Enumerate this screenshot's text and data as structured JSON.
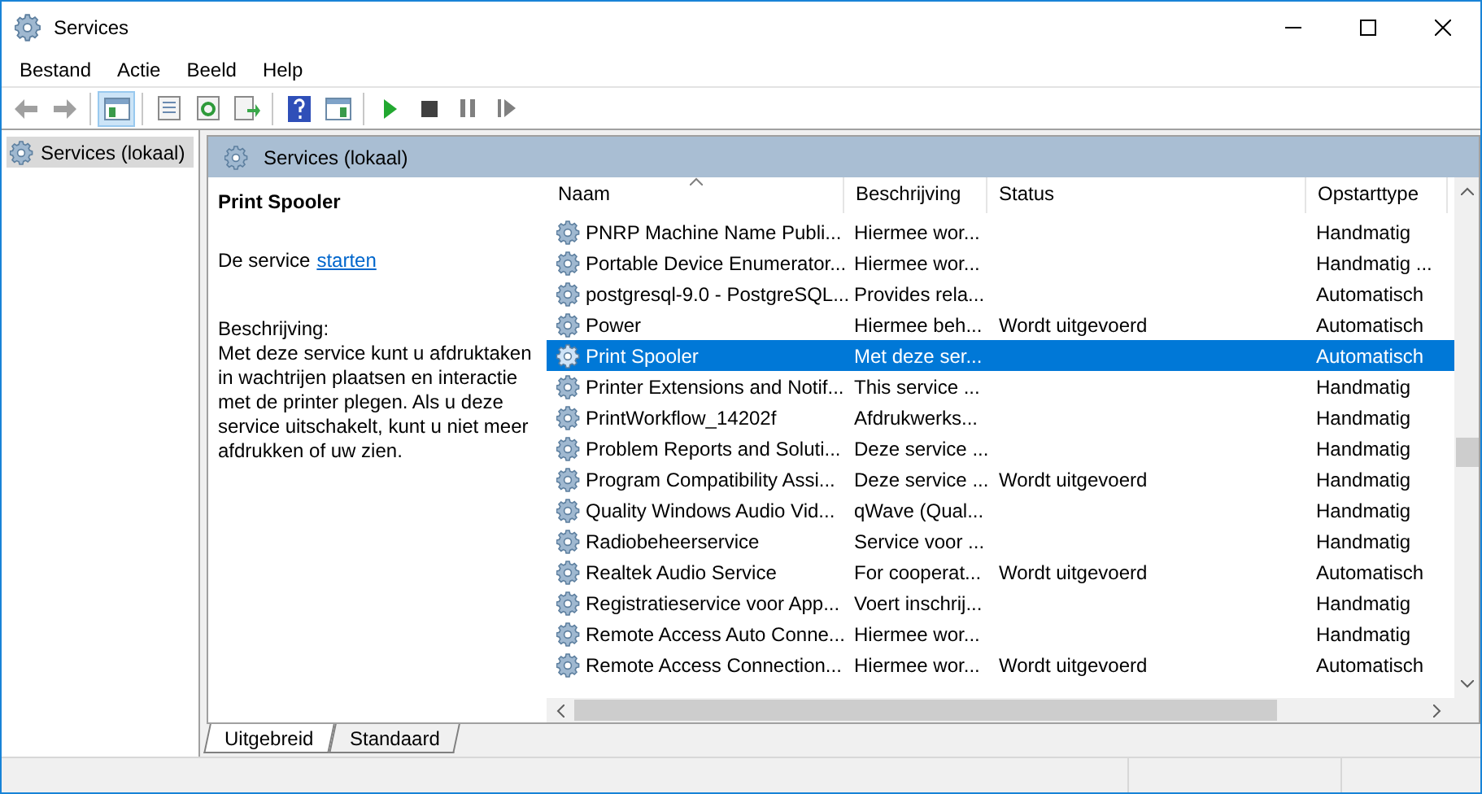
{
  "window": {
    "title": "Services"
  },
  "menu": [
    "Bestand",
    "Actie",
    "Beeld",
    "Help"
  ],
  "tree": {
    "items": [
      {
        "label": "Services (lokaal)",
        "selected": true
      }
    ]
  },
  "pane_header": {
    "title": "Services (lokaal)"
  },
  "details": {
    "title": "Print Spooler",
    "action_prefix": "De service",
    "action_link": "starten",
    "description_label": "Beschrijving:",
    "description": "Met deze service kunt u afdruktaken in wachtrijen plaatsen en interactie met de printer plegen. Als u deze service uitschakelt, kunt u niet meer afdrukken of uw zien."
  },
  "table": {
    "columns": [
      "Naam",
      "Beschrijving",
      "Status",
      "Opstarttype"
    ],
    "rows": [
      {
        "name": "PNRP Machine Name Publi...",
        "description": "Hiermee wor...",
        "status": "",
        "startup": "Handmatig",
        "selected": false
      },
      {
        "name": "Portable Device Enumerator...",
        "description": "Hiermee wor...",
        "status": "",
        "startup": "Handmatig ...",
        "selected": false
      },
      {
        "name": "postgresql-9.0 - PostgreSQL...",
        "description": "Provides rela...",
        "status": "",
        "startup": "Automatisch",
        "selected": false
      },
      {
        "name": "Power",
        "description": "Hiermee beh...",
        "status": "Wordt uitgevoerd",
        "startup": "Automatisch",
        "selected": false
      },
      {
        "name": "Print Spooler",
        "description": "Met deze ser...",
        "status": "",
        "startup": "Automatisch",
        "selected": true
      },
      {
        "name": "Printer Extensions and Notif...",
        "description": "This service ...",
        "status": "",
        "startup": "Handmatig",
        "selected": false
      },
      {
        "name": "PrintWorkflow_14202f",
        "description": "Afdrukwerks...",
        "status": "",
        "startup": "Handmatig",
        "selected": false
      },
      {
        "name": "Problem Reports and Soluti...",
        "description": "Deze service ...",
        "status": "",
        "startup": "Handmatig",
        "selected": false
      },
      {
        "name": "Program Compatibility Assi...",
        "description": "Deze service ...",
        "status": "Wordt uitgevoerd",
        "startup": "Handmatig",
        "selected": false
      },
      {
        "name": "Quality Windows Audio Vid...",
        "description": "qWave (Qual...",
        "status": "",
        "startup": "Handmatig",
        "selected": false
      },
      {
        "name": "Radiobeheerservice",
        "description": "Service voor ...",
        "status": "",
        "startup": "Handmatig",
        "selected": false
      },
      {
        "name": "Realtek Audio Service",
        "description": "For cooperat...",
        "status": "Wordt uitgevoerd",
        "startup": "Automatisch",
        "selected": false
      },
      {
        "name": "Registratieservice voor App...",
        "description": "Voert inschrij...",
        "status": "",
        "startup": "Handmatig",
        "selected": false
      },
      {
        "name": "Remote Access Auto Conne...",
        "description": "Hiermee wor...",
        "status": "",
        "startup": "Handmatig",
        "selected": false
      },
      {
        "name": "Remote Access Connection...",
        "description": "Hiermee wor...",
        "status": "Wordt uitgevoerd",
        "startup": "Automatisch",
        "selected": false
      }
    ]
  },
  "tabs": [
    {
      "label": "Uitgebreid",
      "selected": true
    },
    {
      "label": "Standaard",
      "selected": false
    }
  ]
}
